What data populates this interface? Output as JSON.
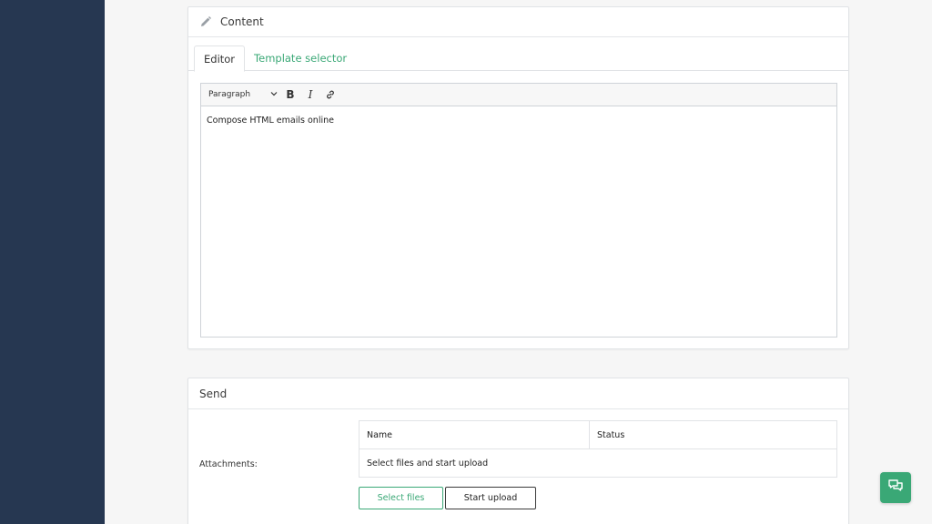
{
  "content_card": {
    "title": "Content",
    "icon": "pencil-icon",
    "tabs": [
      {
        "label": "Editor",
        "active": true
      },
      {
        "label": "Template selector",
        "active": false
      }
    ],
    "editor": {
      "format_value": "Paragraph",
      "bold_label": "B",
      "italic_label": "I",
      "body_text": "Compose HTML emails online"
    }
  },
  "send_card": {
    "title": "Send",
    "attachments_label": "Attachments:",
    "table": {
      "columns": [
        "Name",
        "Status"
      ],
      "empty_message": "Select files and start upload"
    },
    "select_files_label": "Select files",
    "start_upload_label": "Start upload"
  },
  "colors": {
    "sidebar": "#263751",
    "accent": "#3aa876"
  },
  "chat": {
    "icon": "chat-icon"
  }
}
